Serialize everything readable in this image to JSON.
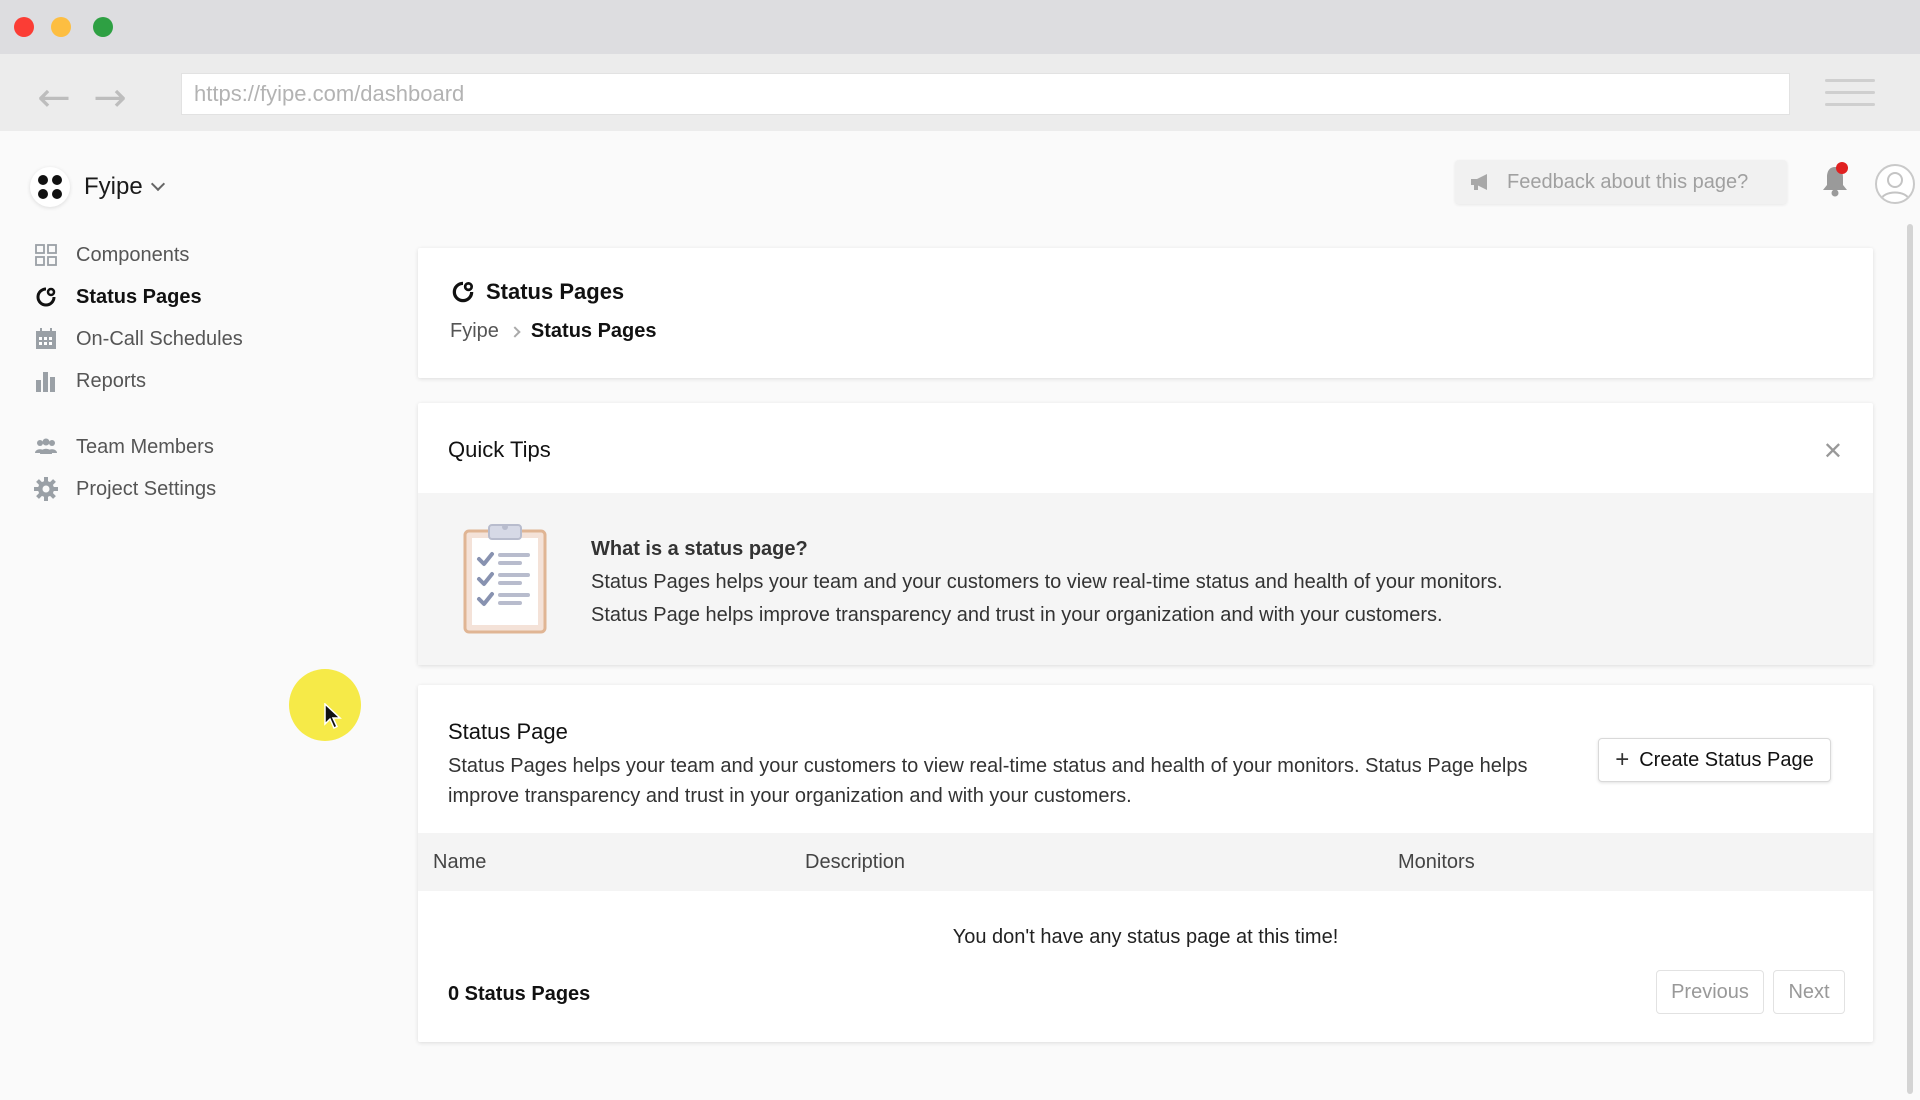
{
  "browser": {
    "url": "https://fyipe.com/dashboard",
    "back_icon": "arrow-left-icon",
    "forward_icon": "arrow-right-icon",
    "menu_icon": "hamburger-icon"
  },
  "topbar": {
    "project_name": "Fyipe",
    "feedback_placeholder": "Feedback about this page?",
    "notification_indicator": true
  },
  "sidebar": {
    "items": [
      {
        "label": "Components",
        "icon": "grid-icon"
      },
      {
        "label": "Status Pages",
        "icon": "status-ring-icon",
        "active": true
      },
      {
        "label": "On-Call Schedules",
        "icon": "calendar-icon"
      },
      {
        "label": "Reports",
        "icon": "bar-chart-icon"
      },
      {
        "label": "Team Members",
        "icon": "team-icon"
      },
      {
        "label": "Project Settings",
        "icon": "gear-icon"
      }
    ]
  },
  "page_header": {
    "title": "Status Pages",
    "breadcrumb": [
      "Fyipe",
      "Status Pages"
    ]
  },
  "quick_tips": {
    "title": "Quick Tips",
    "question": "What is a status page?",
    "line1": "Status Pages helps your team and your customers to view real-time status and health of your monitors.",
    "line2": "Status Page helps improve transparency and trust in your organization and with your customers."
  },
  "status_page_list": {
    "title": "Status Page",
    "description": "Status Pages helps your team and your customers to view real-time status and health of your monitors. Status Page helps improve transparency and trust in your organization and with your customers.",
    "create_button": "Create Status Page",
    "columns": [
      "Name",
      "Description",
      "Monitors"
    ],
    "empty_message": "You don't have any status page at this time!",
    "count_label": "0 Status Pages",
    "prev_label": "Previous",
    "next_label": "Next"
  },
  "colors": {
    "accent_dark": "#111111",
    "notification_dot": "#e02020",
    "cursor_highlight": "#f5e628"
  }
}
